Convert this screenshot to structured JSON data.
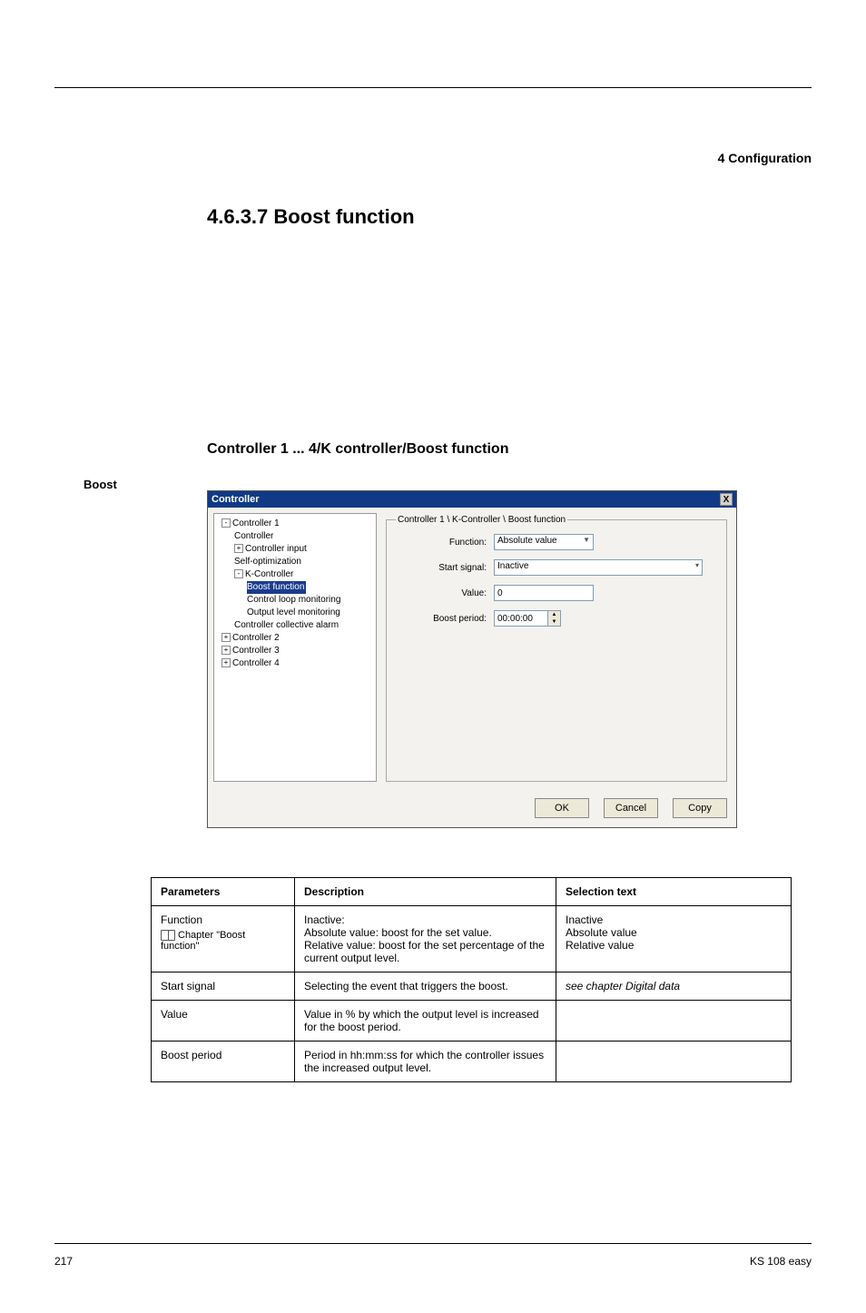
{
  "header": {
    "right": "4 Configuration"
  },
  "footer": {
    "left": "217",
    "right": "KS 108 easy"
  },
  "headings": {
    "chapter": "4.6.3.7 Boost function",
    "section_label": "Boost",
    "section_title": "Controller 1 ... 4/K controller/Boost function"
  },
  "dialog": {
    "title": "Controller",
    "close_glyph": "X",
    "tree": {
      "controller1": "Controller 1",
      "controller": "Controller",
      "controller_input": "Controller input",
      "self_opt": "Self-optimization",
      "k_controller": "K-Controller",
      "boost_function": "Boost function",
      "control_loop_mon": "Control loop monitoring",
      "output_level_mon": "Output level monitoring",
      "coll_alarm": "Controller collective alarm",
      "controller2": "Controller 2",
      "controller3": "Controller 3",
      "controller4": "Controller 4"
    },
    "legend": "Controller 1 \\ K-Controller \\ Boost function",
    "labels": {
      "function": "Function:",
      "start_signal": "Start signal:",
      "value": "Value:",
      "boost_period": "Boost period:"
    },
    "values": {
      "function": "Absolute value",
      "start_signal": "Inactive",
      "value": "0",
      "boost_period": "00:00:00"
    },
    "buttons": {
      "ok": "OK",
      "cancel": "Cancel",
      "copy": "Copy"
    }
  },
  "table": {
    "headers": {
      "parameters": "Parameters",
      "description": "Description",
      "selection_text": "Selection text"
    },
    "rows": [
      {
        "param_line1": "Function",
        "param_note": "Chapter \"Boost function\"",
        "desc_line1": "Inactive:",
        "desc_line2": "Absolute value: boost for the set value.",
        "desc_line3": "Relative value: boost for the set percentage of the current output level.",
        "sel_line1": "Inactive",
        "sel_line2": "Absolute value",
        "sel_line3": "Relative value"
      },
      {
        "param": "Start signal",
        "desc": "Selecting the event that triggers the boost.",
        "sel_ital": "see chapter Digital data"
      },
      {
        "param": "Value",
        "desc": "Value in % by which the output level is increased for the boost period.",
        "sel": ""
      },
      {
        "param": "Boost period",
        "desc": "Period in hh:mm:ss for which the controller issues the increased output level.",
        "sel": ""
      }
    ]
  }
}
